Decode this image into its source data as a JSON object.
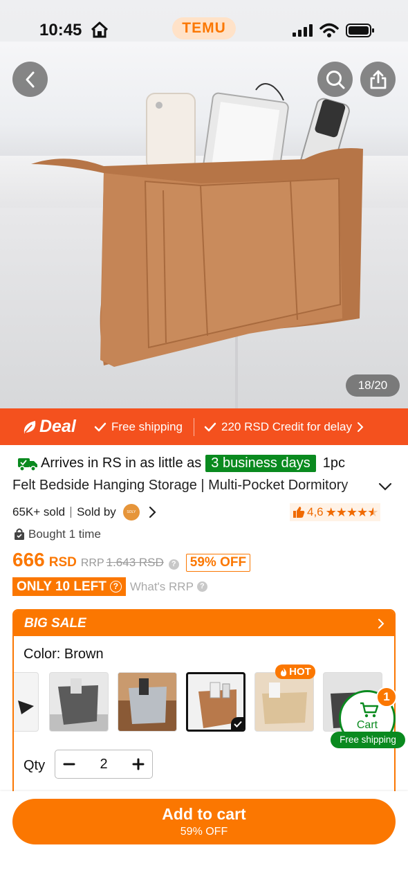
{
  "status_bar": {
    "time": "10:45",
    "brand": "TEMU"
  },
  "gallery": {
    "counter": "18/20"
  },
  "deal_banner": {
    "label": "Deal",
    "free_shipping": "Free shipping",
    "credit": "220 RSD Credit for delay"
  },
  "delivery": {
    "prefix": "Arrives in RS in as little as",
    "days": "3 business days",
    "suffix": "1pc"
  },
  "product": {
    "title": "Felt Bedside Hanging Storage | Multi-Pocket Dormitory",
    "sold": "65K+ sold",
    "sold_by": "Sold by",
    "seller_logo_text": "SOLY REN",
    "rating": "4,6",
    "rating_value": 4.6,
    "bought": "Bought 1 time"
  },
  "price": {
    "current": "666",
    "currency": "RSD",
    "rrp_label": "RRP",
    "rrp_value": "1.643 RSD",
    "discount": "59% OFF",
    "stock": "ONLY 10 LEFT",
    "rrp_link": "What's RRP"
  },
  "sale_card": {
    "header": "BIG SALE",
    "color_label": "Color: Brown",
    "hot_badge": "HOT",
    "qty_label": "Qty",
    "qty_value": "2"
  },
  "cart": {
    "label": "Cart",
    "count": "1",
    "free_shipping": "Free shipping"
  },
  "cta": {
    "label": "Add to cart",
    "sub": "59% OFF"
  },
  "colors": {
    "accent": "#fb7701",
    "deal_red": "#f4511e",
    "green": "#0a8a1f"
  }
}
